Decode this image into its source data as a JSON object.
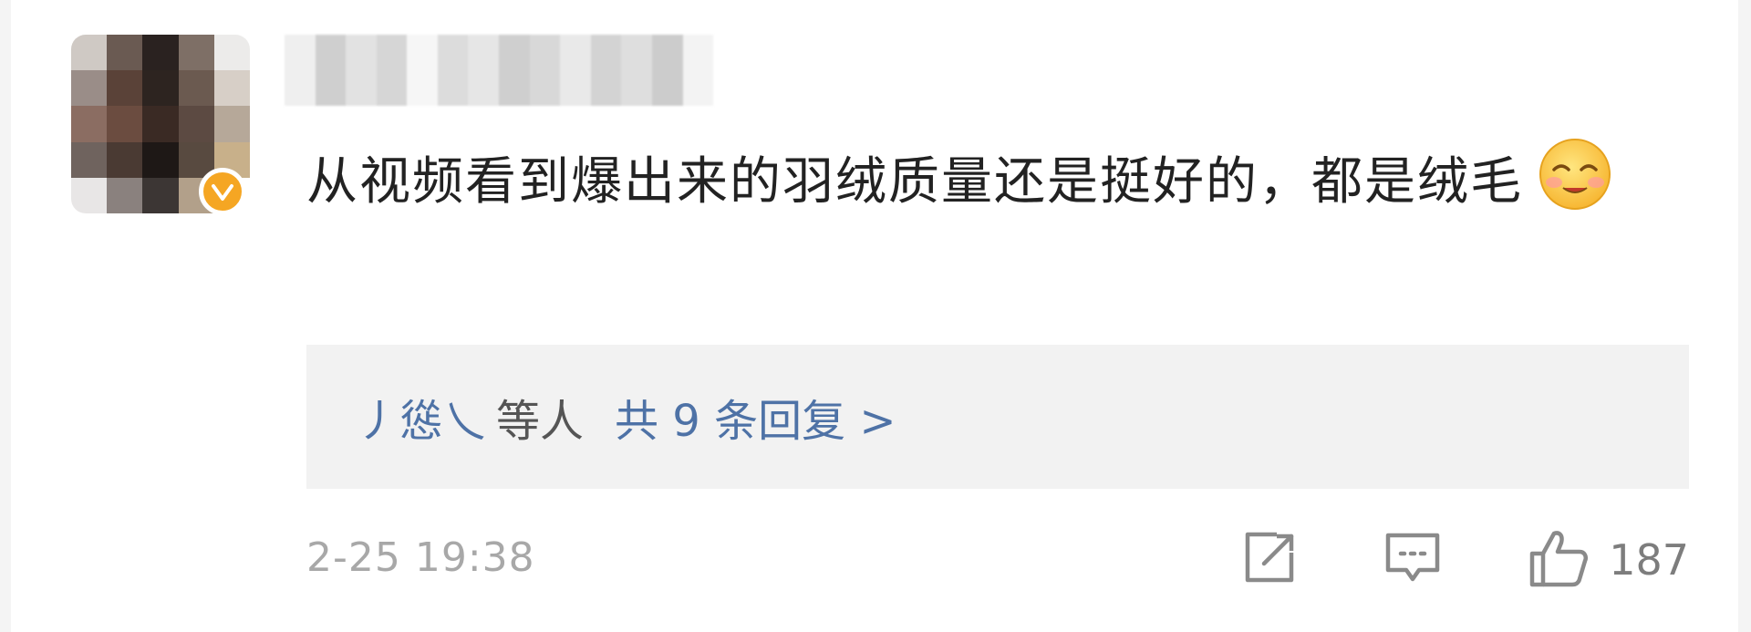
{
  "comment": {
    "text": "从视频看到爆出来的羽绒质量还是挺好的，都是绒毛",
    "emoji": "smiling-face-emoji"
  },
  "replies": {
    "first_replier": "丿慫乀",
    "others_label": "等人",
    "count_label": "共 9 条回复 >"
  },
  "meta": {
    "timestamp": "2-25 19:38"
  },
  "actions": {
    "share_icon": "share-icon",
    "comment_icon": "comment-icon",
    "like_icon": "thumbs-up-icon",
    "like_count": "187"
  },
  "colors": {
    "reply_link": "#4e72a6",
    "reply_bg": "#f2f2f2",
    "meta_text": "#a8a8a8",
    "verified_badge": "#f5a623"
  }
}
